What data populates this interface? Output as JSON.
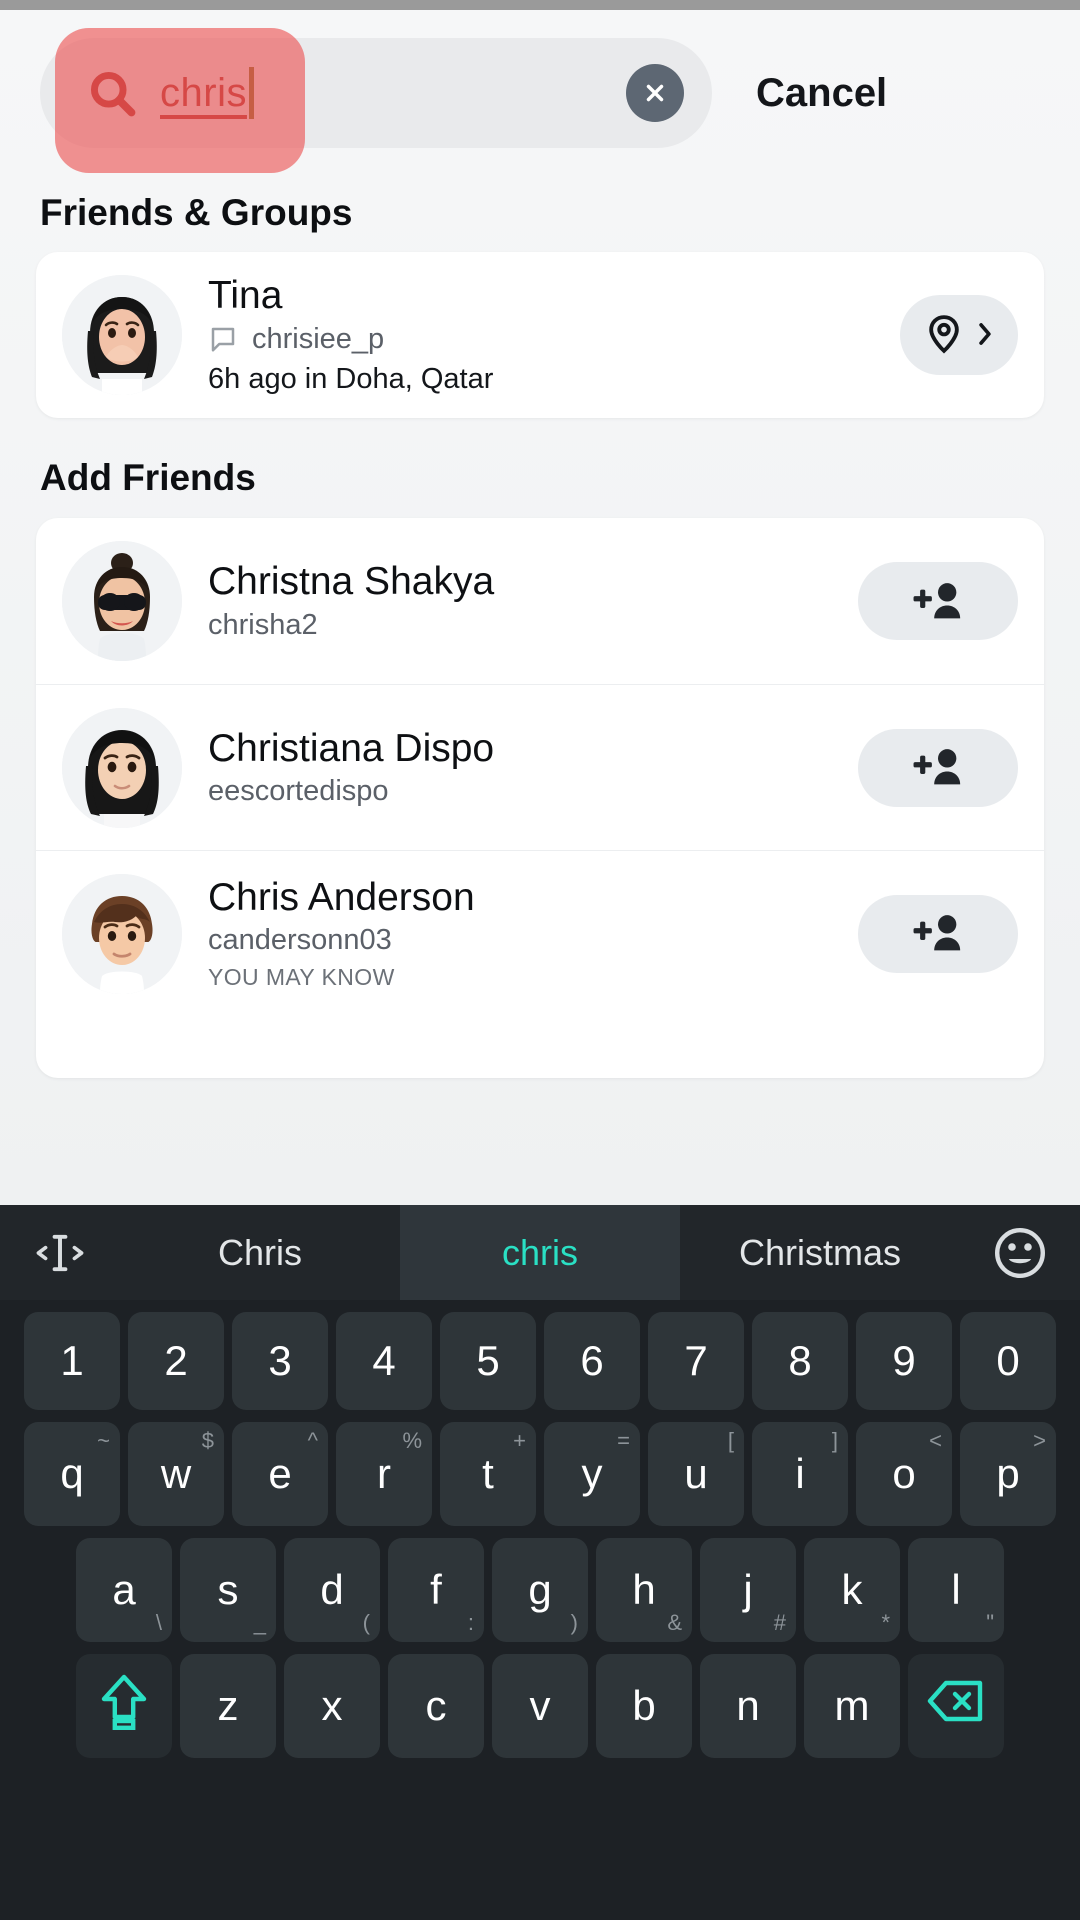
{
  "search": {
    "query": "chris",
    "search_icon": "search-icon",
    "clear_icon": "close-circle-icon",
    "cancel_label": "Cancel"
  },
  "sections": {
    "friends_groups_title": "Friends & Groups",
    "add_friends_title": "Add Friends"
  },
  "friends": [
    {
      "name": "Tina",
      "username": "chrisiee_p",
      "meta": "6h ago in Doha, Qatar",
      "chat_icon": "chat-bubble-icon",
      "action_icon": "location-pin-icon",
      "chevron_icon": "chevron-right-icon"
    }
  ],
  "add_friends": [
    {
      "name": "Christna Shakya",
      "username": "chrisha2",
      "tag": "",
      "action_icon": "add-person-icon"
    },
    {
      "name": "Christiana Dispo",
      "username": "eescortedispo",
      "tag": "",
      "action_icon": "add-person-icon"
    },
    {
      "name": "Chris Anderson",
      "username": "candersonn03",
      "tag": "YOU MAY KNOW",
      "action_icon": "add-person-icon"
    }
  ],
  "keyboard": {
    "cursor_icon": "text-cursor-move-icon",
    "emoji_icon": "emoji-face-icon",
    "suggestions": [
      {
        "label": "Chris",
        "active": false
      },
      {
        "label": "chris",
        "active": true
      },
      {
        "label": "Christmas",
        "active": false
      }
    ],
    "numbers": [
      "1",
      "2",
      "3",
      "4",
      "5",
      "6",
      "7",
      "8",
      "9",
      "0"
    ],
    "row_qwerty": [
      {
        "key": "q",
        "alt": "~"
      },
      {
        "key": "w",
        "alt": "$"
      },
      {
        "key": "e",
        "alt": "^"
      },
      {
        "key": "r",
        "alt": "%"
      },
      {
        "key": "t",
        "alt": "+"
      },
      {
        "key": "y",
        "alt": "="
      },
      {
        "key": "u",
        "alt": "["
      },
      {
        "key": "i",
        "alt": "]"
      },
      {
        "key": "o",
        "alt": "<"
      },
      {
        "key": "p",
        "alt": ">"
      }
    ],
    "row_asdf": [
      {
        "key": "a",
        "alt": "\\"
      },
      {
        "key": "s",
        "alt": "_"
      },
      {
        "key": "d",
        "alt": "("
      },
      {
        "key": "f",
        "alt": ":"
      },
      {
        "key": "g",
        "alt": ")"
      },
      {
        "key": "h",
        "alt": "&"
      },
      {
        "key": "j",
        "alt": "#"
      },
      {
        "key": "k",
        "alt": "*"
      },
      {
        "key": "l",
        "alt": "\""
      }
    ],
    "row_zxcv": [
      {
        "key": "z",
        "alt": ""
      },
      {
        "key": "x",
        "alt": ""
      },
      {
        "key": "c",
        "alt": ""
      },
      {
        "key": "v",
        "alt": ""
      },
      {
        "key": "b",
        "alt": ""
      },
      {
        "key": "n",
        "alt": ""
      },
      {
        "key": "m",
        "alt": ""
      }
    ],
    "shift_icon": "shift-arrow-icon",
    "backspace_icon": "backspace-icon"
  },
  "colors": {
    "tap_highlight": "#ec5050",
    "accent_teal": "#2ae0c4",
    "keyboard_bg": "#1d2125",
    "key_bg": "#2e3539",
    "search_text": "#b23b36"
  }
}
